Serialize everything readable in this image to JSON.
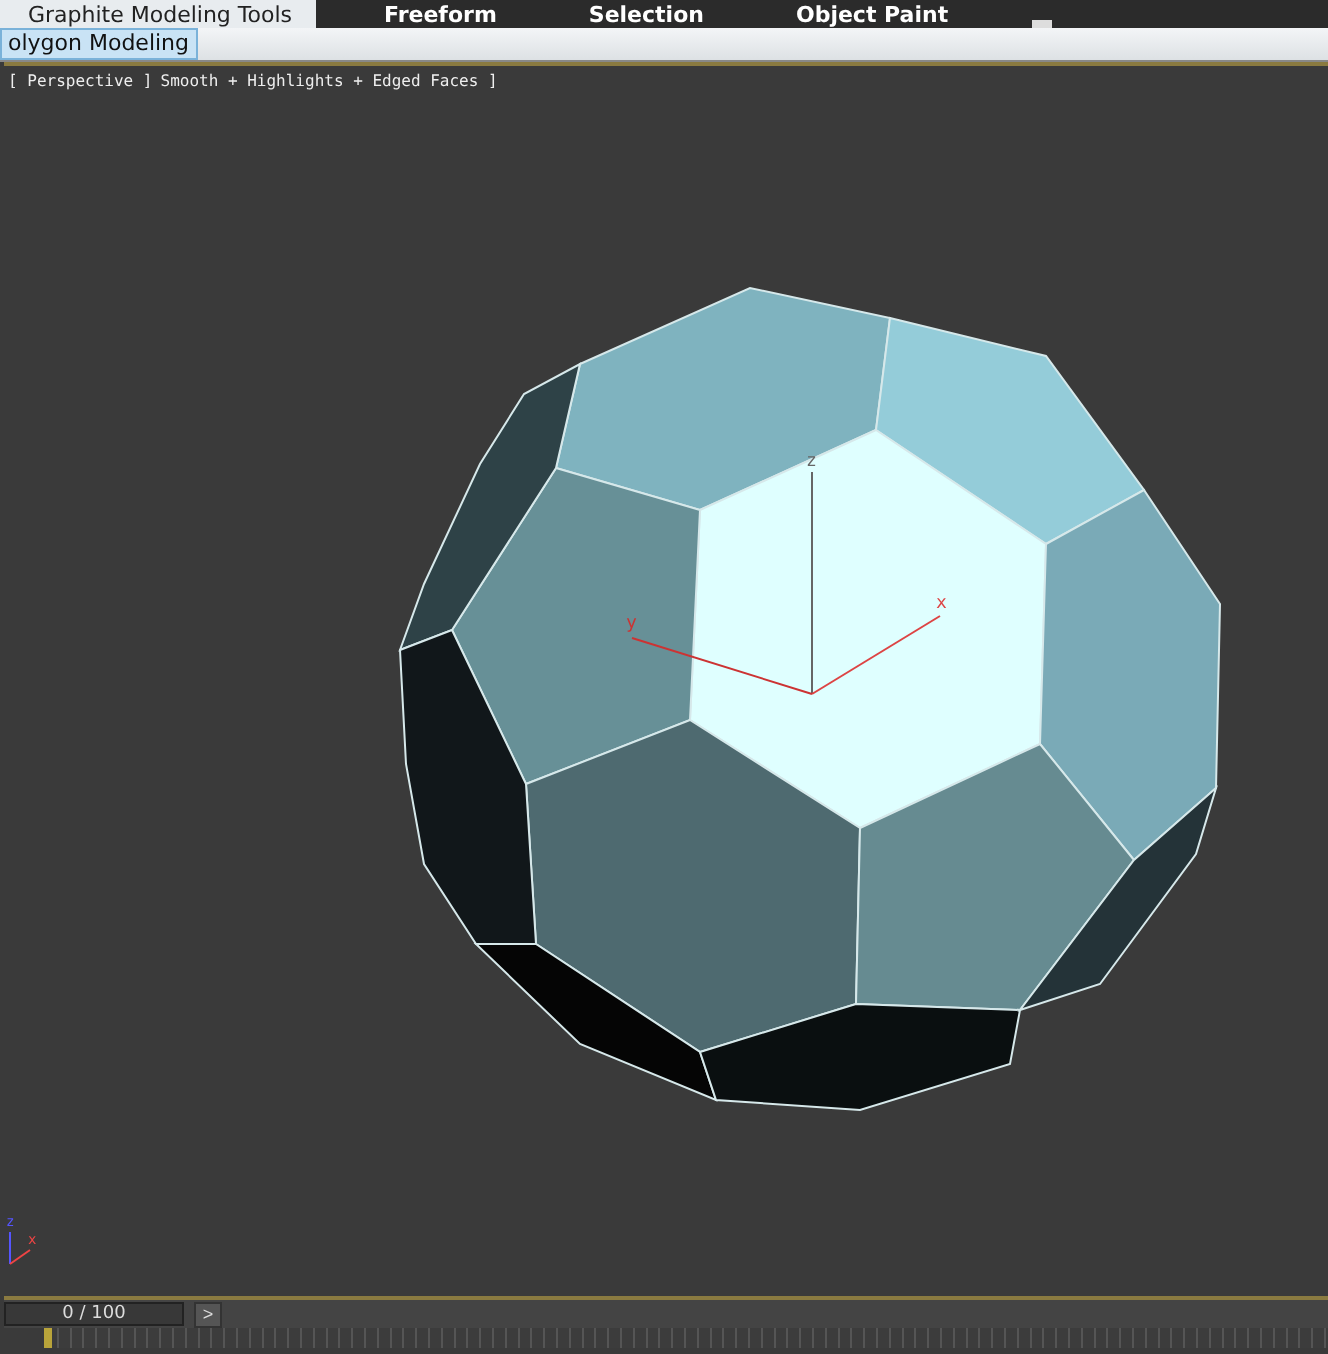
{
  "ribbon_tabs": [
    {
      "label": "Graphite Modeling Tools",
      "selected": true
    },
    {
      "label": "Freeform",
      "selected": false
    },
    {
      "label": "Selection",
      "selected": false
    },
    {
      "label": "Object Paint",
      "selected": false
    }
  ],
  "panel_tabs": [
    {
      "label": "olygon Modeling",
      "selected": true
    }
  ],
  "viewport": {
    "label_parts": [
      "[ Perspective ]",
      "Smooth + Highlights + Edged Faces ]"
    ],
    "gizmo_axes": [
      {
        "label": "z"
      },
      {
        "label": "x"
      },
      {
        "label": "y"
      }
    ],
    "corner_axes": [
      {
        "label": "z"
      },
      {
        "label": "x"
      }
    ]
  },
  "time_slider": {
    "reading": "0 / 100",
    "next": ">",
    "level": 0
  }
}
